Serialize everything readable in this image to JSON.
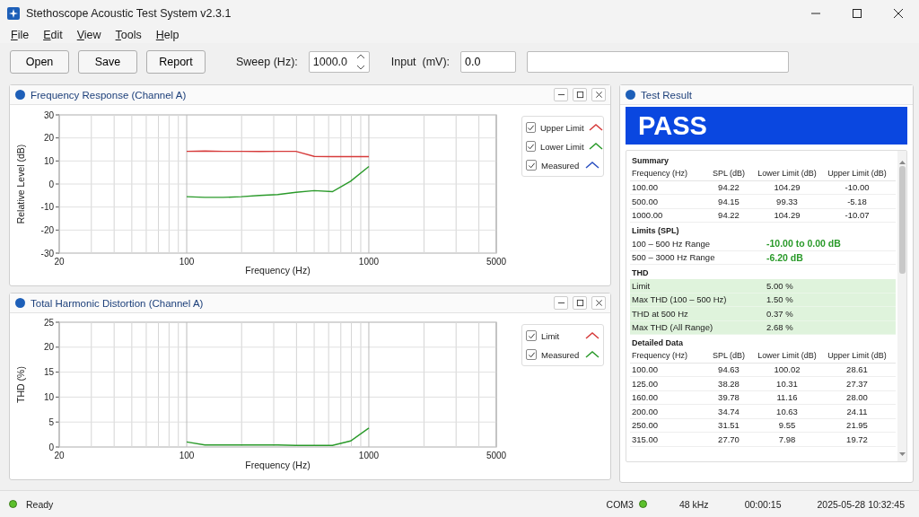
{
  "window": {
    "title": "Stethoscope Acoustic Test System v2.3.1"
  },
  "menu": [
    {
      "label": "File"
    },
    {
      "label": "Edit"
    },
    {
      "label": "View"
    },
    {
      "label": "Tools"
    },
    {
      "label": "Help"
    }
  ],
  "toolbar": {
    "buttons": [
      "Open",
      "Save",
      "Report"
    ],
    "sweep": {
      "label": "Sweep (Hz):",
      "value": "1000.0"
    },
    "input": {
      "label": "Input  (mV):",
      "value": "0.0"
    }
  },
  "panels": [
    {
      "title": "Frequency Response (Channel A)",
      "legend": [
        {
          "checked": true
        },
        {
          "checked": true
        },
        {
          "checked": true
        }
      ],
      "chart_data": {
        "type": "line",
        "grid": true,
        "xlabel": "Frequency (Hz)",
        "ylabel": "Relative Level (dB)",
        "categories": [
          "20",
          null,
          null,
          null,
          null,
          null,
          null,
          "100",
          null,
          null,
          null,
          null,
          null,
          null,
          null,
          null,
          null,
          "1000",
          null,
          null,
          null,
          null,
          null,
          null,
          "5000"
        ],
        "ylim": [
          -30,
          30
        ],
        "yticks": [
          -30,
          -20,
          -10,
          0,
          10,
          20,
          30
        ],
        "series": [
          {
            "name": "Upper Limit",
            "color": "#d63a3a",
            "values": [
              null,
              null,
              null,
              null,
              null,
              null,
              null,
              14.2,
              14.3,
              14.2,
              14.2,
              14.1,
              14.2,
              14.2,
              12.0,
              11.9,
              11.9,
              11.9,
              null,
              null,
              null,
              null,
              null,
              null,
              null
            ]
          },
          {
            "name": "Lower Limit",
            "color": "#2a9a2a",
            "values": [
              null,
              null,
              null,
              null,
              null,
              null,
              null,
              -5.5,
              -5.8,
              -5.8,
              -5.5,
              -5.0,
              -4.6,
              -3.6,
              -2.9,
              -3.3,
              1.2,
              7.6,
              null,
              null,
              null,
              null,
              null,
              null,
              null
            ]
          },
          {
            "name": "Measured",
            "color": "#2a4fc0",
            "values": [
              null,
              null,
              null,
              null,
              null,
              null,
              null,
              null,
              null,
              null,
              null,
              null,
              null,
              null,
              null,
              null,
              null,
              null,
              null,
              null,
              null,
              null,
              null,
              null,
              null
            ]
          }
        ]
      }
    },
    {
      "title": "Total Harmonic Distortion (Channel A)",
      "legend": [
        {
          "checked": true
        },
        {
          "checked": true
        }
      ],
      "chart_data": {
        "type": "line",
        "grid": true,
        "xlabel": "Frequency (Hz)",
        "ylabel": "THD (%)",
        "categories": [
          "20",
          null,
          null,
          null,
          null,
          null,
          null,
          "100",
          null,
          null,
          null,
          null,
          null,
          null,
          null,
          null,
          null,
          "1000",
          null,
          null,
          null,
          null,
          null,
          null,
          "5000"
        ],
        "ylim": [
          0,
          25
        ],
        "yticks": [
          0,
          5,
          10,
          15,
          20,
          25
        ],
        "series": [
          {
            "name": "Limit",
            "color": "#d63a3a",
            "values": [
              null,
              null,
              null,
              null,
              null,
              null,
              null,
              null,
              null,
              null,
              null,
              null,
              null,
              null,
              null,
              null,
              null,
              null,
              null,
              null,
              null,
              null,
              null,
              null,
              null
            ]
          },
          {
            "name": "Measured",
            "color": "#2a9a2a",
            "values": [
              null,
              null,
              null,
              null,
              null,
              null,
              null,
              1.0,
              0.4,
              0.4,
              0.4,
              0.4,
              0.4,
              0.3,
              0.3,
              0.3,
              1.2,
              3.8,
              null,
              null,
              null,
              null,
              null,
              null,
              null
            ]
          }
        ]
      }
    }
  ],
  "result": {
    "title": "Test Result",
    "verdict": "PASS",
    "sections": [
      {
        "kind": "table",
        "title": "Summary",
        "columns": [
          "Frequency (Hz)",
          "SPL (dB)",
          "Lower Limit (dB)",
          "Upper Limit (dB)"
        ],
        "rows": [
          [
            "100.00",
            "94.22",
            "104.29",
            "-10.00"
          ],
          [
            "500.00",
            "94.15",
            "99.33",
            "-5.18"
          ],
          [
            "1000.00",
            "94.22",
            "104.29",
            "-10.07"
          ]
        ]
      },
      {
        "kind": "pairs",
        "title": "Limits (SPL)",
        "highlighted": false,
        "rows": [
          {
            "label": "100 – 500 Hz  Range",
            "value": "-10.00 to 0.00 dB",
            "pass": true
          },
          {
            "label": "500 – 3000 Hz Range",
            "value": "-6.20 dB",
            "pass": true
          }
        ]
      },
      {
        "kind": "pairs",
        "title": "THD",
        "highlighted": true,
        "rows": [
          {
            "label": "Limit",
            "value": "5.00 %",
            "pass": false
          },
          {
            "label": "Max THD (100 – 500 Hz)",
            "value": "1.50 %",
            "pass": false
          },
          {
            "label": "THD at 500 Hz",
            "value": "0.37 %",
            "pass": false
          },
          {
            "label": "Max THD (All Range)",
            "value": "2.68 %",
            "pass": false
          }
        ]
      },
      {
        "kind": "table",
        "title": "Detailed Data",
        "columns": [
          "Frequency (Hz)",
          "SPL (dB)",
          "Lower Limit (dB)",
          "Upper Limit (dB)"
        ],
        "rows": [
          [
            "100.00",
            "94.63",
            "100.02",
            "28.61"
          ],
          [
            "125.00",
            "38.28",
            "10.31",
            "27.37"
          ],
          [
            "160.00",
            "39.78",
            "11.16",
            "28.00"
          ],
          [
            "200.00",
            "34.74",
            "10.63",
            "24.11"
          ],
          [
            "250.00",
            "31.51",
            "9.55",
            "21.95"
          ],
          [
            "315.00",
            "27.70",
            "7.98",
            "19.72"
          ]
        ]
      }
    ]
  },
  "status_bar": {
    "status": "Ready",
    "status_ok": true,
    "port": "COM3",
    "port_ok": true,
    "rate": "48 kHz",
    "elapsed": "00:00:15",
    "datetime": "2025-05-28 10:32:45"
  }
}
